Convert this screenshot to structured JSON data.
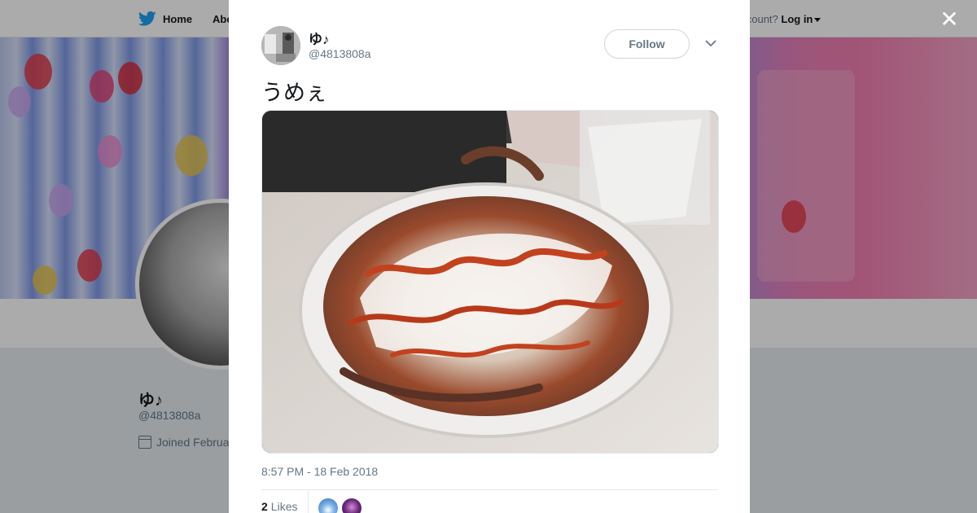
{
  "nav": {
    "home_label": "Home",
    "about_label": "Abo",
    "account_prompt": "account?",
    "login_label": "Log in"
  },
  "profile": {
    "name": "ゆ♪",
    "handle": "@4813808a",
    "joined": "Joined Februa"
  },
  "modal": {
    "close_icon": "close-icon",
    "author_name": "ゆ♪",
    "author_handle": "@4813808a",
    "follow_label": "Follow",
    "tweet_text": "うめぇ",
    "timestamp": "8:57 PM - 18 Feb 2018",
    "likes_count": "2",
    "likes_label": "Likes"
  },
  "colors": {
    "twitter_blue": "#1da1f2",
    "text_primary": "#14171a",
    "text_secondary": "#657786",
    "border": "#e1e8ed"
  }
}
